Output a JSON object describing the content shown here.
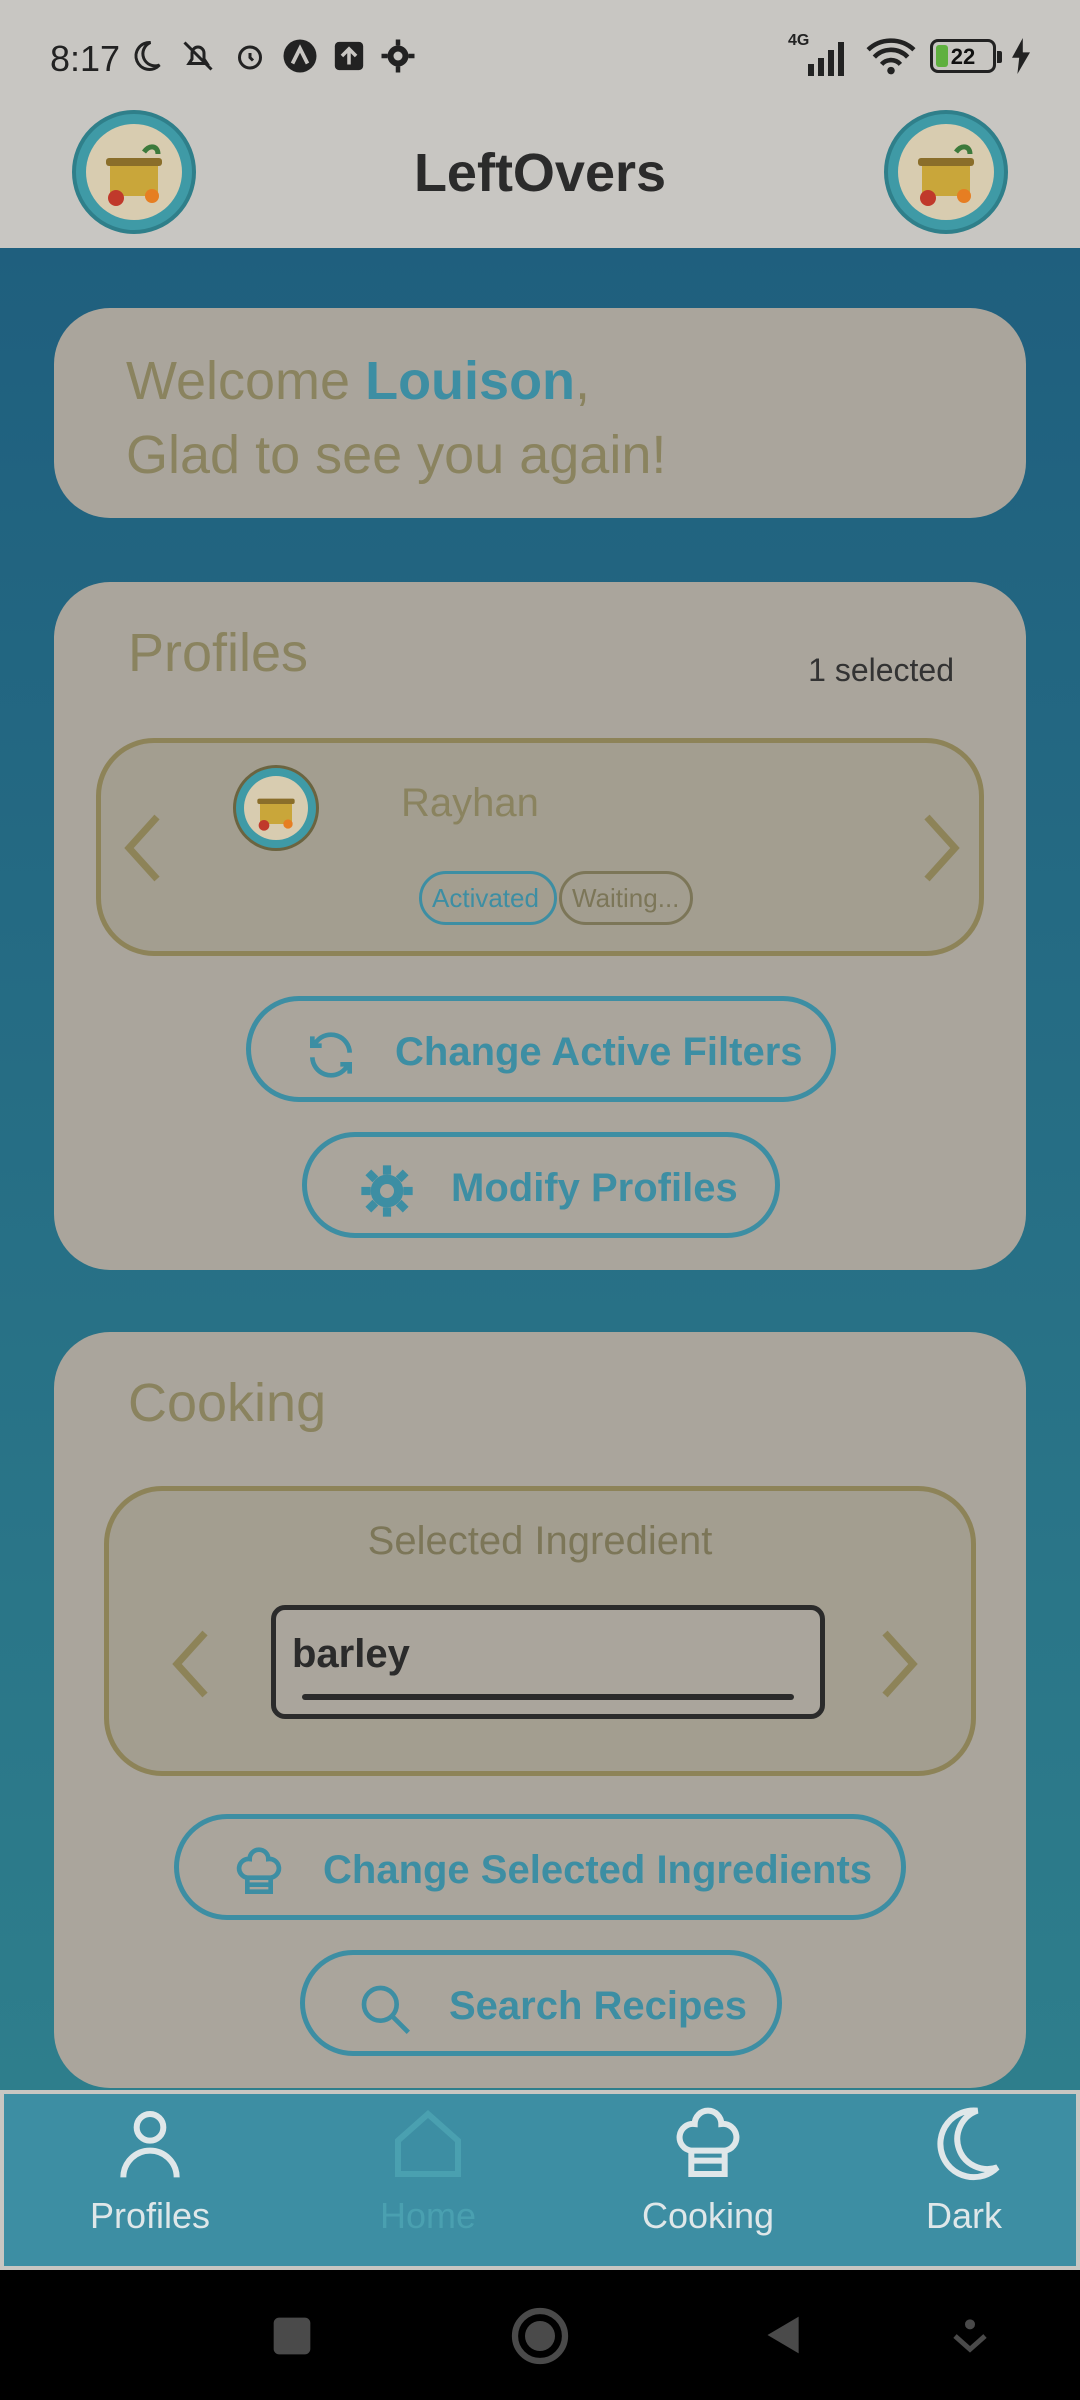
{
  "status_bar": {
    "time": "8:17",
    "network_label": "4G",
    "battery_level": "22",
    "battery_percent": 22
  },
  "header": {
    "title": "LeftOvers"
  },
  "welcome": {
    "prefix": "Welcome ",
    "user": "Louison",
    "suffix": ",",
    "subtitle": "Glad to see you again!"
  },
  "profiles": {
    "title": "Profiles",
    "selected_count": "1 selected",
    "current_profile": {
      "name": "Rayhan",
      "badges": [
        "Activated",
        "Waiting..."
      ]
    },
    "change_filters_label": "Change Active Filters",
    "modify_profiles_label": "Modify Profiles"
  },
  "cooking": {
    "title": "Cooking",
    "selected_ingredient_title": "Selected Ingredient",
    "ingredient_value": "barley",
    "change_ingredients_label": "Change Selected Ingredients",
    "search_recipes_label": "Search Recipes"
  },
  "bottom_nav": {
    "items": [
      {
        "label": "Profiles",
        "icon": "person-icon"
      },
      {
        "label": "Home",
        "icon": "home-icon"
      },
      {
        "label": "Cooking",
        "icon": "chef-hat-icon"
      },
      {
        "label": "Dark",
        "icon": "moon-icon"
      }
    ]
  },
  "colors": {
    "accent": "#3d8ea3",
    "card": "#aaa59c",
    "olive": "#8d8358",
    "header": "#c8c6c2"
  }
}
